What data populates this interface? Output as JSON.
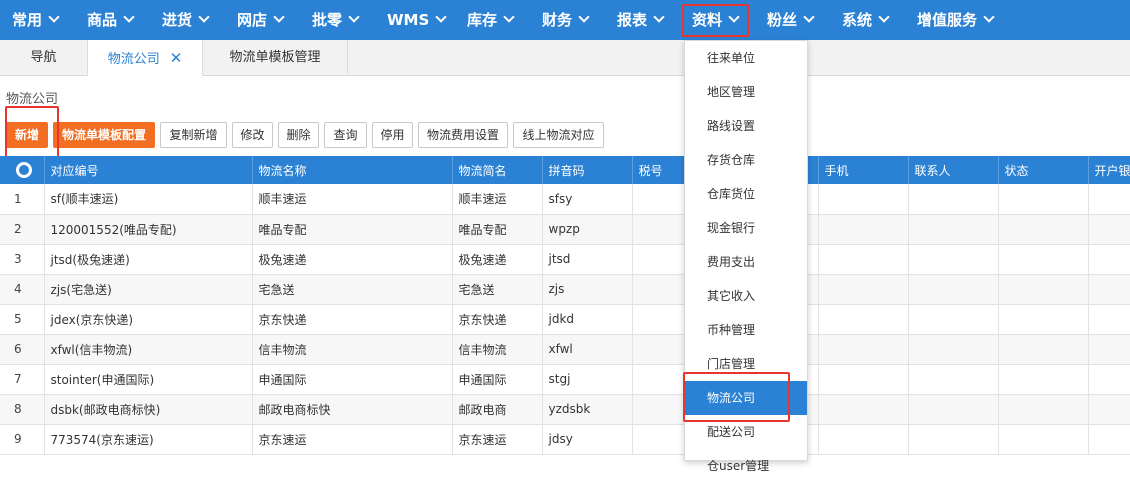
{
  "topnav": {
    "items": [
      "常用",
      "商品",
      "进货",
      "网店",
      "批零",
      "WMS",
      "库存",
      "财务",
      "报表",
      "资料",
      "粉丝",
      "系统",
      "增值服务"
    ]
  },
  "tabs": {
    "items": [
      "导航",
      "物流公司",
      "物流单模板管理"
    ],
    "close_glyph": "✕"
  },
  "breadcrumb": "物流公司",
  "toolbar": {
    "buttons": [
      "新增",
      "物流单模板配置",
      "复制新增",
      "修改",
      "删除",
      "查询",
      "停用",
      "物流费用设置",
      "线上物流对应"
    ]
  },
  "table": {
    "columns": [
      "对应编号",
      "物流名称",
      "物流简名",
      "拼音码",
      "税号",
      "",
      "手机",
      "联系人",
      "状态",
      "开户银行"
    ],
    "rows": [
      [
        "1",
        "sf(顺丰速运)",
        "顺丰速运",
        "顺丰速运",
        "sfsy"
      ],
      [
        "2",
        "120001552(唯品专配)",
        "唯品专配",
        "唯品专配",
        "wpzp"
      ],
      [
        "3",
        "jtsd(极兔速递)",
        "极兔速递",
        "极兔速递",
        "jtsd"
      ],
      [
        "4",
        "zjs(宅急送)",
        "宅急送",
        "宅急送",
        "zjs"
      ],
      [
        "5",
        "jdex(京东快递)",
        "京东快递",
        "京东快递",
        "jdkd"
      ],
      [
        "6",
        "xfwl(信丰物流)",
        "信丰物流",
        "信丰物流",
        "xfwl"
      ],
      [
        "7",
        "stointer(申通国际)",
        "申通国际",
        "申通国际",
        "stgj"
      ],
      [
        "8",
        "dsbk(邮政电商标快)",
        "邮政电商标快",
        "邮政电商",
        "yzdsbk"
      ],
      [
        "9",
        "773574(京东速运)",
        "京东速运",
        "京东速运",
        "jdsy"
      ]
    ]
  },
  "dropdown": {
    "items": [
      "往来单位",
      "地区管理",
      "路线设置",
      "存货仓库",
      "仓库货位",
      "现金银行",
      "费用支出",
      "其它收入",
      "币种管理",
      "门店管理",
      "物流公司",
      "配送公司",
      "仓user管理"
    ],
    "active_index": 10
  },
  "colors": {
    "accent": "#2b82d4",
    "orange": "#f16e22",
    "highlight": "#e8362c"
  }
}
